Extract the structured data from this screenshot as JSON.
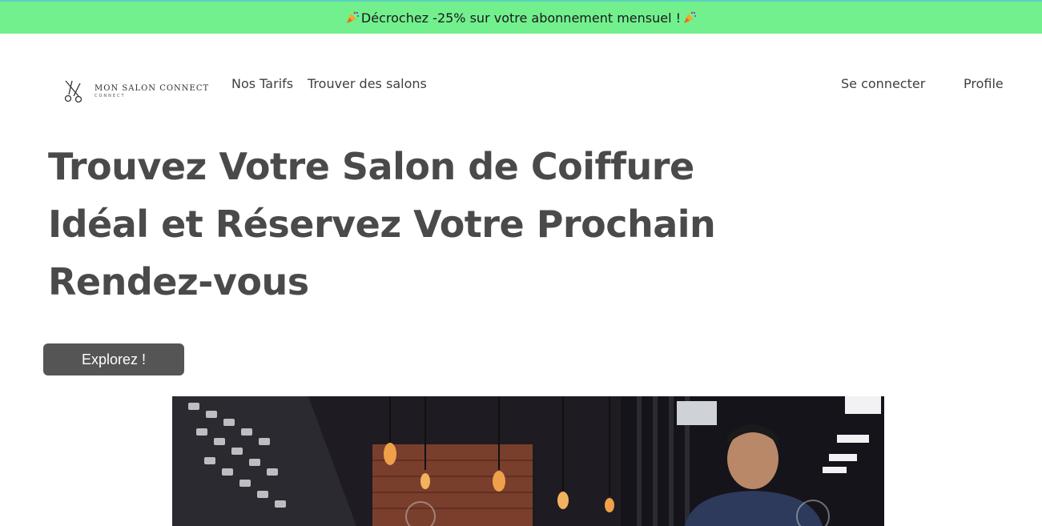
{
  "promo": {
    "text": "Décrochez -25% sur votre abonnement mensuel !",
    "icon": "party-popper-icon",
    "background": "#72f08d"
  },
  "brand": {
    "name": "MON SALON CONNECT",
    "tagline": "CONNECT",
    "icon": "scissors-icon"
  },
  "nav": {
    "tarifs": "Nos Tarifs",
    "salons": "Trouver des salons",
    "login": "Se connecter",
    "profile": "Profile"
  },
  "hero": {
    "title": "Trouvez Votre Salon de Coiffure Idéal et Réservez Votre Prochain Rendez-vous",
    "cta": "Explorez !"
  },
  "colors": {
    "text": "#4a4a4a",
    "button": "#555555"
  }
}
